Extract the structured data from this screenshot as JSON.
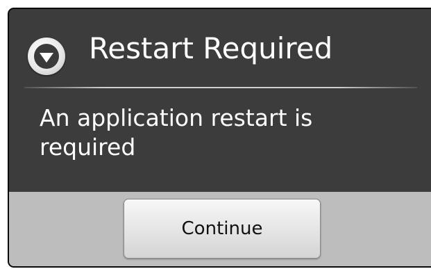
{
  "dialog": {
    "title": "Restart Required",
    "title_icon": "info-down-arrow-icon",
    "message": "An application restart is required",
    "continue_label": "Continue"
  },
  "colors": {
    "dialog_background": "#3c3c3c",
    "button_bar_background": "#bdbdbd",
    "text_primary": "#ffffff",
    "button_text": "#111111"
  }
}
